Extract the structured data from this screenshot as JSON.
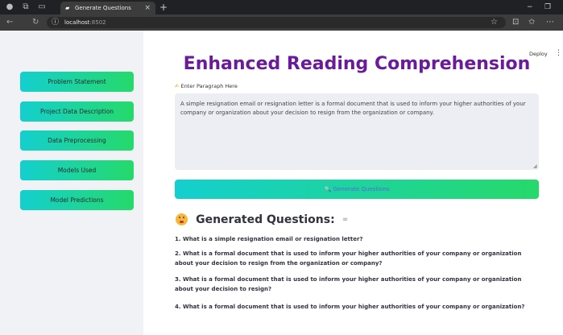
{
  "browser": {
    "tab_title": "Generate Questions",
    "tab_close": "×",
    "new_tab": "+",
    "url_host": "localhost",
    "url_port": ":8502",
    "minimize": "−",
    "restore": "❐"
  },
  "header": {
    "deploy_label": "Deploy",
    "menu_glyph": "⋮"
  },
  "sidebar": {
    "items": [
      {
        "label": "Problem Statement"
      },
      {
        "label": "Project Data Description"
      },
      {
        "label": "Data Preprocessing"
      },
      {
        "label": "Models Used"
      },
      {
        "label": "Model Predictions"
      }
    ]
  },
  "main": {
    "title": "Enhanced Reading Comprehension",
    "input_label": "Enter Paragraph Here",
    "input_value": "A simple resignation email or resignation letter is a formal document that is used to inform your higher authorities of your company or organization about your decision to resign from the organization or company.",
    "generate_button": "Generate Questions",
    "generated_heading": "Generated Questions:",
    "questions": [
      "1. What is a simple resignation email or resignation letter?",
      "2. What is a formal document that is used to inform your higher authorities of your company or organization about your decision to resign from the organization or company?",
      "3. What is a formal document that is used to inform your higher authorities of your company or organization about your decision to resign?",
      "4. What is a formal document that is used to inform your higher authorities of your company or organization?"
    ]
  },
  "colors": {
    "title": "#6a1b9a",
    "button_gradient_start": "#14cfcf",
    "button_gradient_end": "#26d96a",
    "sidebar_bg": "#f0f2f6"
  }
}
